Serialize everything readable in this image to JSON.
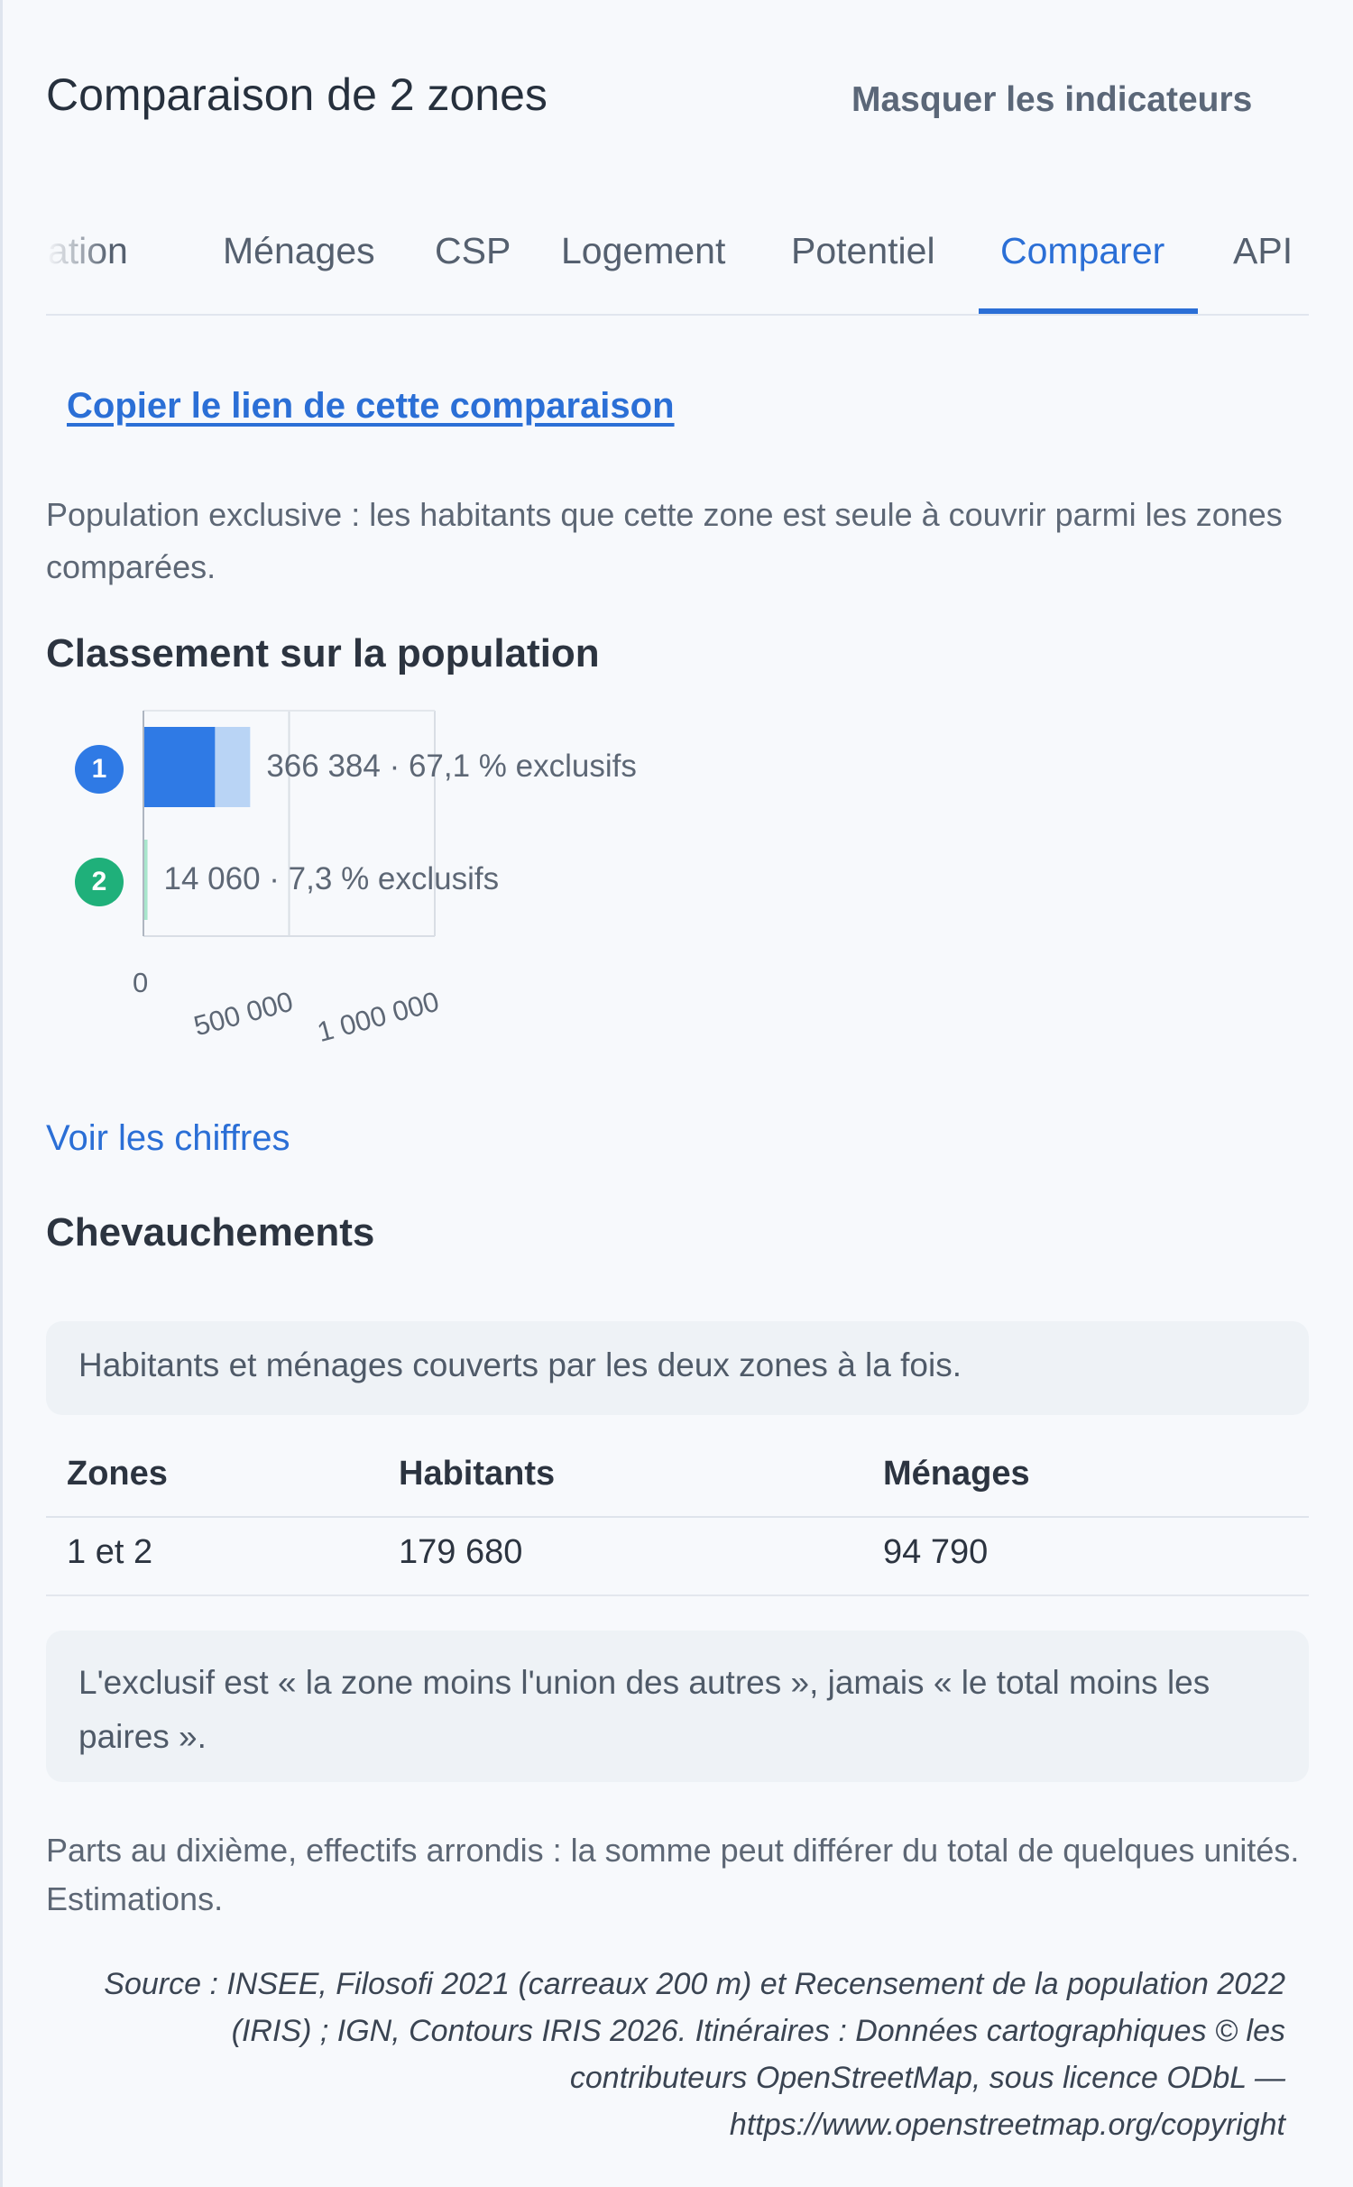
{
  "header": {
    "title": "Comparaison de 2 zones",
    "hide_link": "Masquer les indicateurs"
  },
  "tabs": [
    {
      "label": "ulation"
    },
    {
      "label": "Ménages"
    },
    {
      "label": "CSP"
    },
    {
      "label": "Logement"
    },
    {
      "label": "Potentiel"
    },
    {
      "label": "Comparer",
      "active": true
    },
    {
      "label": "API"
    }
  ],
  "copy_link": "Copier le lien de cette comparaison",
  "exclusive_description": "Population exclusive : les habitants que cette zone est seule à couvrir parmi les zones comparées.",
  "ranking_title": "Classement sur la population",
  "chart_data": {
    "type": "bar",
    "orientation": "horizontal",
    "stacked": true,
    "categories": [
      "1",
      "2"
    ],
    "series": [
      {
        "values": [
          245843,
          1026
        ],
        "role": "exclusive"
      },
      {
        "values": [
          120541,
          13034
        ],
        "role": "shared"
      }
    ],
    "totals": [
      366384,
      14060
    ],
    "exclusive_share_pct": [
      67.1,
      7.3
    ],
    "bar_labels": [
      "366 384 · 67,1 % exclusifs",
      "14 060 · 7,3 % exclusifs"
    ],
    "xlim": [
      0,
      1000000
    ],
    "x_ticks": [
      0,
      500000,
      1000000
    ],
    "x_tick_labels": [
      "0",
      "500 000",
      "1 000 000"
    ],
    "colors": {
      "zone1_exclusive": "#2f7ae5",
      "zone1_shared": "#b9d4f5",
      "zone2_exclusive": "#1fb07a",
      "zone2_shared": "#a8e6cc",
      "zone1_badge": "#2f7ae5",
      "zone2_badge": "#1fb07a"
    },
    "grid": true
  },
  "see_figures": "Voir les chiffres",
  "overlap_title": "Chevauchements",
  "overlap_note": "Habitants et ménages couverts par les deux zones à la fois.",
  "overlap_table": {
    "headers": [
      "Zones",
      "Habitants",
      "Ménages"
    ],
    "rows": [
      [
        "1 et 2",
        "179 680",
        "94 790"
      ]
    ]
  },
  "exclusive_note": "L'exclusif est « la zone moins l'union des autres », jamais « le total moins les paires ».",
  "rounding_note": "Parts au dixième, effectifs arrondis : la somme peut différer du total de quelques unités. Estimations.",
  "source_text": "Source : INSEE, Filosofi 2021 (carreaux 200 m) et Recensement de la population 2022 (IRIS) ; IGN, Contours IRIS 2026. Itinéraires : Données cartographiques © les contributeurs OpenStreetMap, sous licence ODbL — https://www.openstreetmap.org/copyright"
}
